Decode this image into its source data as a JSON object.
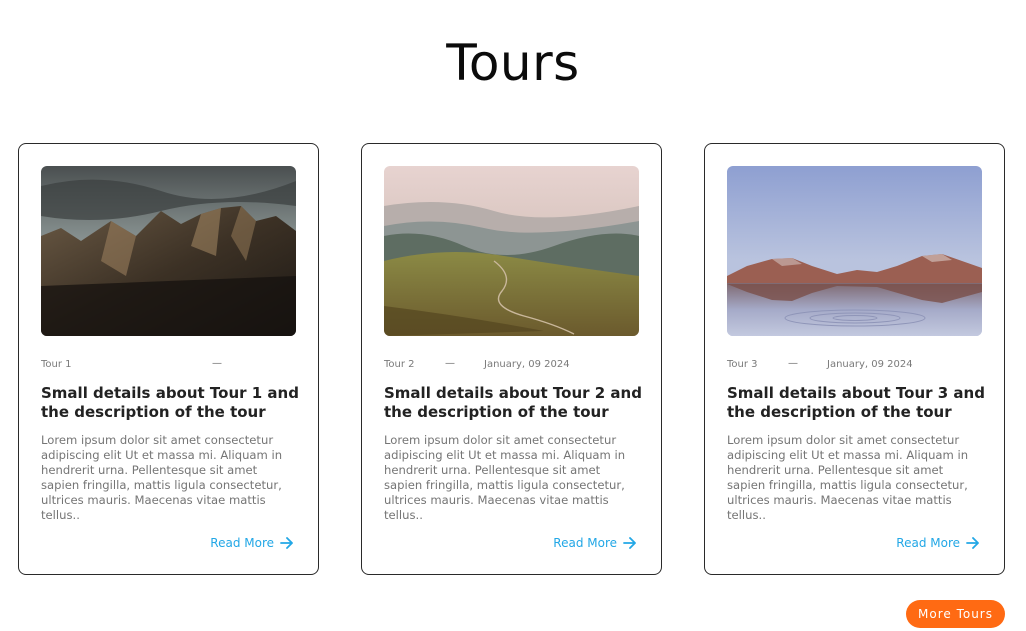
{
  "page": {
    "title": "Tours"
  },
  "tours": [
    {
      "label": "Tour 1",
      "date": "",
      "title": "Small details about Tour 1 and the description of the tour",
      "description": "Lorem ipsum dolor sit amet consectetur adipiscing elit Ut et massa mi. Aliquam in hendrerit urna. Pellentesque sit amet sapien fringilla, mattis ligula consectetur, ultrices mauris. Maecenas vitae mattis tellus..",
      "read_more": "Read More"
    },
    {
      "label": "Tour  2",
      "date": "January, 09 2024",
      "title": "Small details about Tour 2 and the description of the tour",
      "description": "Lorem ipsum dolor sit amet consectetur adipiscing elit Ut et massa mi. Aliquam in hendrerit urna. Pellentesque sit amet sapien fringilla, mattis ligula consectetur, ultrices mauris. Maecenas vitae mattis tellus..",
      "read_more": "Read More"
    },
    {
      "label": "Tour 3",
      "date": "January, 09 2024",
      "title": "Small details about Tour 3 and the description of the tour",
      "description": "Lorem ipsum dolor sit amet consectetur adipiscing elit Ut et massa mi. Aliquam in hendrerit urna. Pellentesque sit amet sapien fringilla, mattis ligula consectetur, ultrices mauris. Maecenas vitae mattis tellus..",
      "read_more": "Read More"
    }
  ],
  "footer": {
    "more_tours": "More Tours"
  },
  "colors": {
    "accent": "#ff6a13",
    "link": "#22a7e6",
    "border": "#2a2a2a"
  },
  "icons": {
    "read_more": "arrow-right-icon"
  }
}
